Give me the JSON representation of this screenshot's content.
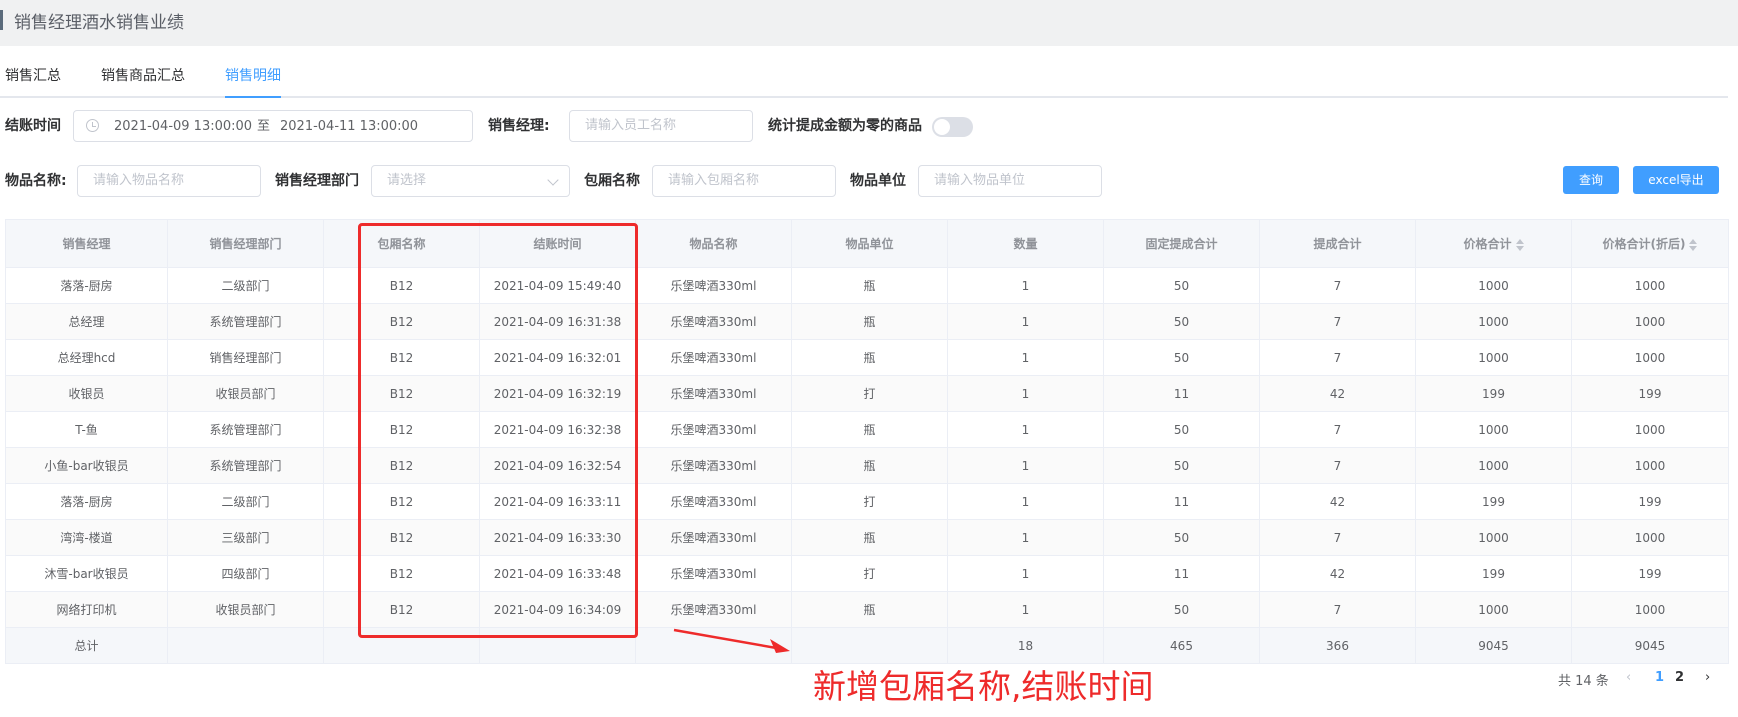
{
  "page_title": "销售经理酒水销售业绩",
  "tabs": [
    {
      "label": "销售汇总"
    },
    {
      "label": "销售商品汇总"
    },
    {
      "label": "销售明细"
    }
  ],
  "filters": {
    "checkout_time_label": "结账时间",
    "date_start": "2021-04-09 13:00:00",
    "date_separator": "至",
    "date_end": "2021-04-11 13:00:00",
    "sales_manager_label": "销售经理:",
    "sales_manager_placeholder": "请输入员工名称",
    "zero_commission_label": "统计提成金额为零的商品",
    "item_name_label": "物品名称:",
    "item_name_placeholder": "请输入物品名称",
    "dept_label": "销售经理部门",
    "dept_placeholder": "请选择",
    "room_label": "包厢名称",
    "room_placeholder": "请输入包厢名称",
    "unit_label": "物品单位",
    "unit_placeholder": "请输入物品单位"
  },
  "buttons": {
    "query": "查询",
    "export": "excel导出"
  },
  "table": {
    "headers": [
      "销售经理",
      "销售经理部门",
      "包厢名称",
      "结账时间",
      "物品名称",
      "物品单位",
      "数量",
      "固定提成合计",
      "提成合计",
      "价格合计",
      "价格合计(折后)"
    ],
    "rows": [
      [
        "落落-厨房",
        "二级部门",
        "B12",
        "2021-04-09 15:49:40",
        "乐堡啤酒330ml",
        "瓶",
        "1",
        "50",
        "7",
        "1000",
        "1000"
      ],
      [
        "总经理",
        "系统管理部门",
        "B12",
        "2021-04-09 16:31:38",
        "乐堡啤酒330ml",
        "瓶",
        "1",
        "50",
        "7",
        "1000",
        "1000"
      ],
      [
        "总经理hcd",
        "销售经理部门",
        "B12",
        "2021-04-09 16:32:01",
        "乐堡啤酒330ml",
        "瓶",
        "1",
        "50",
        "7",
        "1000",
        "1000"
      ],
      [
        "收银员",
        "收银员部门",
        "B12",
        "2021-04-09 16:32:19",
        "乐堡啤酒330ml",
        "打",
        "1",
        "11",
        "42",
        "199",
        "199"
      ],
      [
        "T-鱼",
        "系统管理部门",
        "B12",
        "2021-04-09 16:32:38",
        "乐堡啤酒330ml",
        "瓶",
        "1",
        "50",
        "7",
        "1000",
        "1000"
      ],
      [
        "小鱼-bar收银员",
        "系统管理部门",
        "B12",
        "2021-04-09 16:32:54",
        "乐堡啤酒330ml",
        "瓶",
        "1",
        "50",
        "7",
        "1000",
        "1000"
      ],
      [
        "落落-厨房",
        "二级部门",
        "B12",
        "2021-04-09 16:33:11",
        "乐堡啤酒330ml",
        "打",
        "1",
        "11",
        "42",
        "199",
        "199"
      ],
      [
        "湾湾-楼道",
        "三级部门",
        "B12",
        "2021-04-09 16:33:30",
        "乐堡啤酒330ml",
        "瓶",
        "1",
        "50",
        "7",
        "1000",
        "1000"
      ],
      [
        "沐雪-bar收银员",
        "四级部门",
        "B12",
        "2021-04-09 16:33:48",
        "乐堡啤酒330ml",
        "打",
        "1",
        "11",
        "42",
        "199",
        "199"
      ],
      [
        "网络打印机",
        "收银员部门",
        "B12",
        "2021-04-09 16:34:09",
        "乐堡啤酒330ml",
        "瓶",
        "1",
        "50",
        "7",
        "1000",
        "1000"
      ]
    ],
    "total": [
      "总计",
      "",
      "",
      "",
      "",
      "",
      "18",
      "465",
      "366",
      "9045",
      "9045"
    ]
  },
  "pagination": {
    "total_text": "共 14 条",
    "prev": "‹",
    "page1": "1",
    "page2": "2",
    "next": "›"
  },
  "annotation": "新增包厢名称,结账时间",
  "colors": {
    "accent": "#409eff",
    "annotation_red": "#ee2b2b"
  }
}
